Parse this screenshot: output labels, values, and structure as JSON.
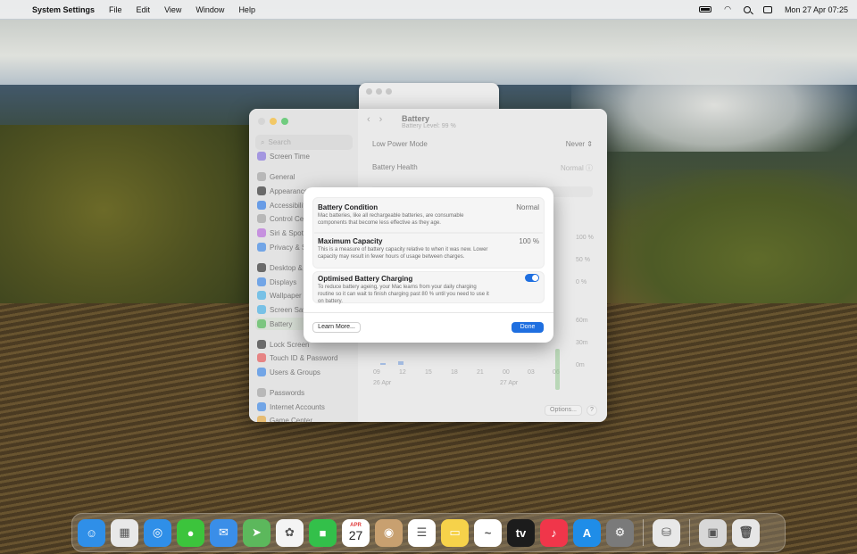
{
  "menubar": {
    "app_name": "System Settings",
    "menus": [
      "File",
      "Edit",
      "View",
      "Window",
      "Help"
    ],
    "clock": "Mon 27 Apr  07:25"
  },
  "settings_window": {
    "sidebar": {
      "search_placeholder": "Search",
      "items": [
        {
          "label": "Screen Time",
          "color": "#7b68d8"
        },
        {
          "label": "General",
          "color": "#9a9a9a"
        },
        {
          "label": "Appearance",
          "color": "#222222"
        },
        {
          "label": "Accessibility",
          "color": "#1f6fe0"
        },
        {
          "label": "Control Centre",
          "color": "#9a9a9a"
        },
        {
          "label": "Siri & Spotlight",
          "color": "#b05fd6"
        },
        {
          "label": "Privacy & Security",
          "color": "#2f7de0"
        },
        {
          "label": "Desktop & Dock",
          "color": "#222222"
        },
        {
          "label": "Displays",
          "color": "#2f7de0"
        },
        {
          "label": "Wallpaper",
          "color": "#38a8e0"
        },
        {
          "label": "Screen Saver",
          "color": "#38a8e0"
        },
        {
          "label": "Battery",
          "color": "#3cb043"
        },
        {
          "label": "Lock Screen",
          "color": "#222222"
        },
        {
          "label": "Touch ID & Password",
          "color": "#e04a4a"
        },
        {
          "label": "Users & Groups",
          "color": "#2f7de0"
        },
        {
          "label": "Passwords",
          "color": "#9a9a9a"
        },
        {
          "label": "Internet Accounts",
          "color": "#2f7de0"
        },
        {
          "label": "Game Center",
          "color": "#e0a030"
        }
      ],
      "selected_index": 11
    },
    "header": {
      "title": "Battery",
      "subtitle": "Battery Level: 99 %"
    },
    "rows": {
      "low_power_label": "Low Power Mode",
      "low_power_value": "Never",
      "health_label": "Battery Health",
      "health_value": "Normal"
    },
    "chart_labels": {
      "y_percent": [
        "100 %",
        "50 %",
        "0 %"
      ],
      "y_time": [
        "60m",
        "30m",
        "0m"
      ],
      "x_hours": [
        "09",
        "12",
        "15",
        "18",
        "21",
        "00",
        "03",
        "06"
      ],
      "x_dates": [
        "26 Apr",
        "27 Apr"
      ]
    },
    "options_label": "Options...",
    "help_label": "?"
  },
  "dialog": {
    "condition_title": "Battery Condition",
    "condition_value": "Normal",
    "condition_desc": "Mac batteries, like all rechargeable batteries, are consumable components that become less effective as they age.",
    "capacity_title": "Maximum Capacity",
    "capacity_value": "100 %",
    "capacity_desc": "This is a measure of battery capacity relative to when it was new. Lower capacity may result in fewer hours of usage between charges.",
    "optimised_title": "Optimised Battery Charging",
    "optimised_desc": "To reduce battery ageing, your Mac learns from your daily charging routine so it can wait to finish charging past 80 % until you need to use it on battery.",
    "optimised_on": true,
    "learn_more": "Learn More...",
    "done": "Done"
  },
  "dock": {
    "apps": [
      {
        "name": "finder-icon",
        "color": "#2f8fe8",
        "glyph": "☺"
      },
      {
        "name": "launchpad-icon",
        "color": "#e8e8e8",
        "glyph": "▦"
      },
      {
        "name": "safari-icon",
        "color": "#2f8fe8",
        "glyph": "◎"
      },
      {
        "name": "messages-icon",
        "color": "#3cc43c",
        "glyph": "●"
      },
      {
        "name": "mail-icon",
        "color": "#3a8ee8",
        "glyph": "✉"
      },
      {
        "name": "maps-icon",
        "color": "#5cb85c",
        "glyph": "➤"
      },
      {
        "name": "photos-icon",
        "color": "#f4f4f4",
        "glyph": "✿"
      },
      {
        "name": "facetime-icon",
        "color": "#33c04a",
        "glyph": "■"
      },
      {
        "name": "calendar-icon",
        "color": "#ffffff",
        "glyph": "27"
      },
      {
        "name": "contacts-icon",
        "color": "#c8a070",
        "glyph": "◉"
      },
      {
        "name": "reminders-icon",
        "color": "#ffffff",
        "glyph": "☰"
      },
      {
        "name": "notes-icon",
        "color": "#f6d24a",
        "glyph": "▭"
      },
      {
        "name": "freeform-icon",
        "color": "#ffffff",
        "glyph": "~"
      },
      {
        "name": "tv-icon",
        "color": "#1c1c1c",
        "glyph": "tv"
      },
      {
        "name": "music-icon",
        "color": "#f0364a",
        "glyph": "♪"
      },
      {
        "name": "app-store-icon",
        "color": "#1f8de8",
        "glyph": "A"
      },
      {
        "name": "system-settings-icon",
        "color": "#7a7a7a",
        "glyph": "⚙"
      },
      {
        "name": "disk-utility-icon",
        "color": "#e8e8e8",
        "glyph": "⛁"
      },
      {
        "name": "preview-icon",
        "color": "#d8d8d8",
        "glyph": "▣"
      },
      {
        "name": "trash-icon",
        "color": "#e6e6e6",
        "glyph": "🗑"
      }
    ],
    "calendar_month": "APR",
    "calendar_day": "27"
  }
}
